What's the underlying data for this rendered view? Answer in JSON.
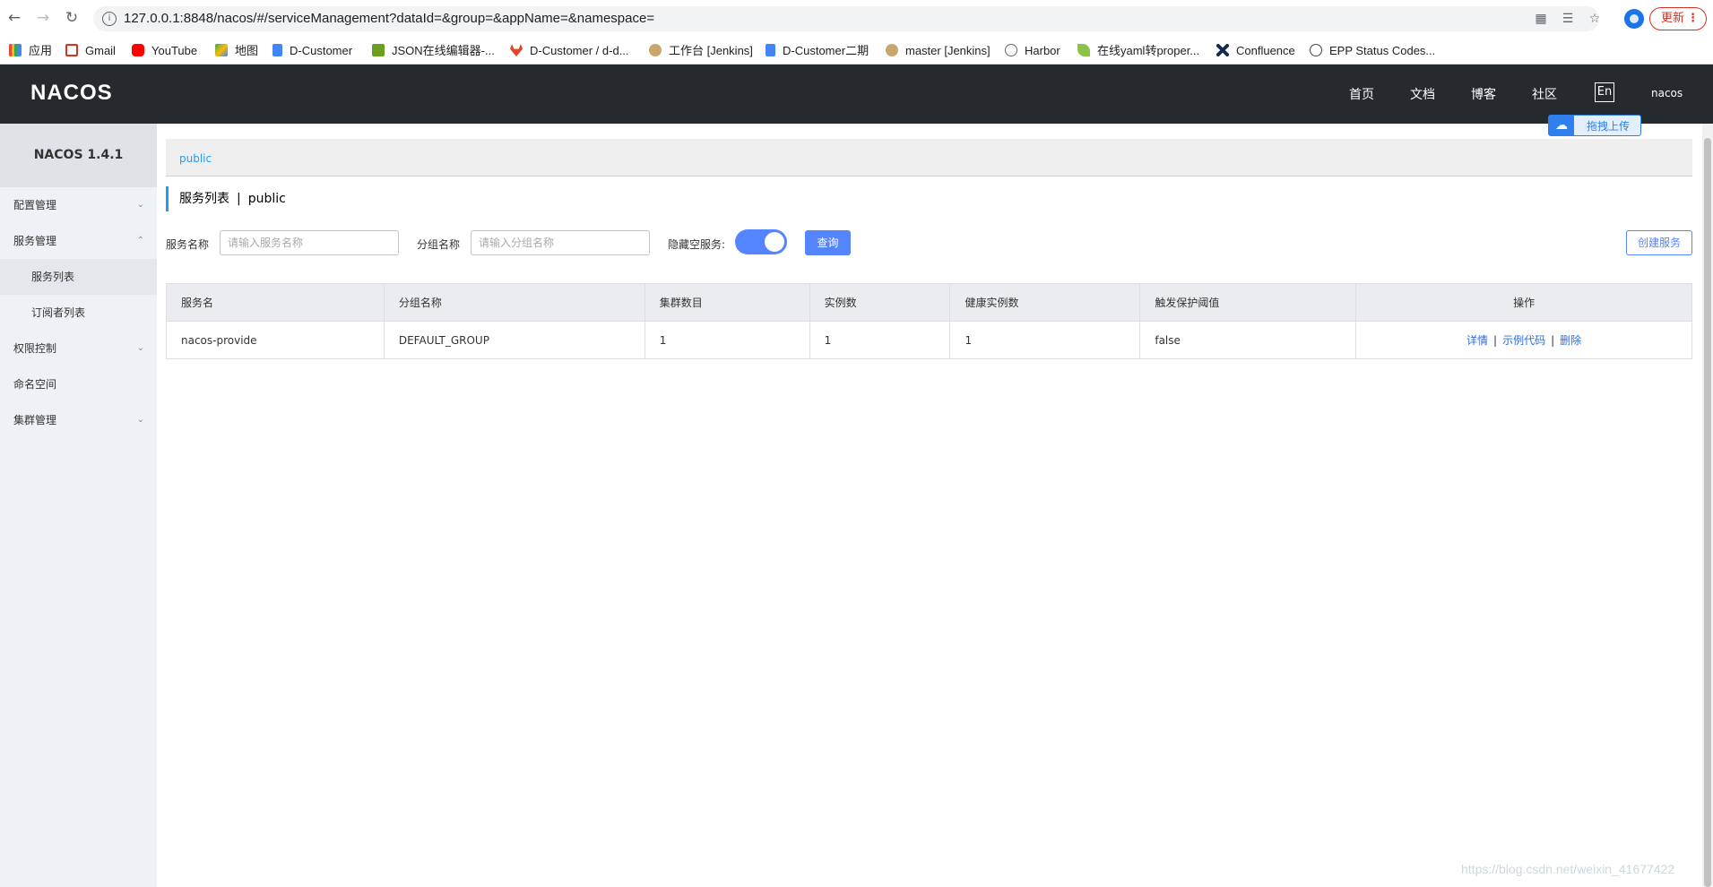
{
  "browser": {
    "url": "127.0.0.1:8848/nacos/#/serviceManagement?dataId=&group=&appName=&namespace=",
    "update_label": "更新",
    "bookmarks": [
      {
        "label": "应用",
        "icon": "apps-grid-icon",
        "color": "#e8453c"
      },
      {
        "label": "Gmail",
        "icon": "gmail-icon",
        "color": "#d93025"
      },
      {
        "label": "YouTube",
        "icon": "youtube-icon",
        "color": "#ff0000"
      },
      {
        "label": "地图",
        "icon": "maps-icon",
        "color": "#34a853"
      },
      {
        "label": "D-Customer",
        "icon": "docs-icon",
        "color": "#4285f4"
      },
      {
        "label": "JSON在线编辑器-...",
        "icon": "json-icon",
        "color": "#6a9f1f"
      },
      {
        "label": "D-Customer / d-d...",
        "icon": "gitlab-icon",
        "color": "#e24329"
      },
      {
        "label": "工作台 [Jenkins]",
        "icon": "jenkins-icon",
        "color": "#c9a66b"
      },
      {
        "label": "D-Customer二期",
        "icon": "docs-icon",
        "color": "#4285f4"
      },
      {
        "label": "master [Jenkins]",
        "icon": "jenkins-icon",
        "color": "#c9a66b"
      },
      {
        "label": "Harbor",
        "icon": "harbor-icon",
        "color": "#666666"
      },
      {
        "label": "在线yaml转proper...",
        "icon": "leaf-icon",
        "color": "#8bc34a"
      },
      {
        "label": "Confluence",
        "icon": "confluence-icon",
        "color": "#172b4d"
      },
      {
        "label": "EPP Status Codes...",
        "icon": "globe-icon",
        "color": "#444444"
      }
    ]
  },
  "header": {
    "logo": "NACOS",
    "menu": [
      "首页",
      "文档",
      "博客",
      "社区"
    ],
    "lang": "En",
    "user": "nacos",
    "upload_label": "拖拽上传"
  },
  "sidebar": {
    "version": "NACOS 1.4.1",
    "items": [
      {
        "label": "配置管理",
        "chevron": "down"
      },
      {
        "label": "服务管理",
        "chevron": "up"
      },
      {
        "label": "服务列表",
        "sub": true,
        "active": true
      },
      {
        "label": "订阅者列表",
        "sub": true
      },
      {
        "label": "权限控制",
        "chevron": "down"
      },
      {
        "label": "命名空间"
      },
      {
        "label": "集群管理",
        "chevron": "down"
      }
    ]
  },
  "main": {
    "namespace_tab": "public",
    "title": "服务列表",
    "title_sep": "|",
    "title_ns": "public",
    "filters": {
      "service_label": "服务名称",
      "service_placeholder": "请输入服务名称",
      "group_label": "分组名称",
      "group_placeholder": "请输入分组名称",
      "hide_empty_label": "隐藏空服务:",
      "hide_empty_on": true,
      "query_label": "查询",
      "create_label": "创建服务"
    },
    "table": {
      "headers": [
        "服务名",
        "分组名称",
        "集群数目",
        "实例数",
        "健康实例数",
        "触发保护阈值",
        "操作"
      ],
      "rows": [
        {
          "name": "nacos-provide",
          "group": "DEFAULT_GROUP",
          "clusters": "1",
          "instances": "1",
          "healthy": "1",
          "threshold": "false",
          "actions": [
            "详情",
            "示例代码",
            "删除"
          ]
        }
      ]
    }
  },
  "watermark": "https://blog.csdn.net/weixin_41677422"
}
